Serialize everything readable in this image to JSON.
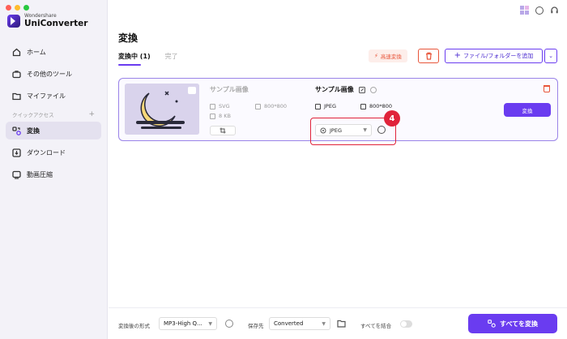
{
  "window": {
    "traffic_colors": [
      "#ff5f57",
      "#febc2e",
      "#28c840"
    ]
  },
  "app": {
    "brand_small": "Wondershare",
    "brand_name": "UniConverter"
  },
  "sidebar": {
    "items_top": [
      {
        "label": "ホーム",
        "icon": "home-icon"
      },
      {
        "label": "その他のツール",
        "icon": "toolbox-icon"
      },
      {
        "label": "マイファイル",
        "icon": "folder-icon"
      }
    ],
    "quick_access_label": "クイックアクセス",
    "quick_access_add": "+",
    "items_quick": [
      {
        "label": "変換",
        "icon": "convert-icon",
        "active": true
      },
      {
        "label": "ダウンロード",
        "icon": "download-icon"
      },
      {
        "label": "動画圧縮",
        "icon": "compress-icon"
      }
    ]
  },
  "header": {
    "title": "変換"
  },
  "tabs": [
    {
      "label": "変換中 (1)",
      "active": true
    },
    {
      "label": "完了",
      "active": false
    }
  ],
  "toolbar": {
    "speed_label": "高速変換",
    "add_label": "ファイル/フォルダーを追加"
  },
  "file": {
    "source_title": "サンプル画像",
    "source_format": "SVG",
    "source_resolution": "800*800",
    "source_size": "8 KB",
    "target_title": "サンプル画像",
    "target_format": "JPEG",
    "target_resolution": "800*800",
    "output_format": "JPEG",
    "convert_label": "変換",
    "step_number": "4"
  },
  "bottom": {
    "format_label": "変換後の形式",
    "format_value": "MP3-High Q...",
    "dest_label": "保存先",
    "dest_value": "Converted",
    "merge_label": "すべてを結合",
    "convert_all_label": "すべてを変換"
  },
  "colors": {
    "accent": "#6a3cf0",
    "danger": "#e8553a",
    "highlight": "#e0233a"
  }
}
